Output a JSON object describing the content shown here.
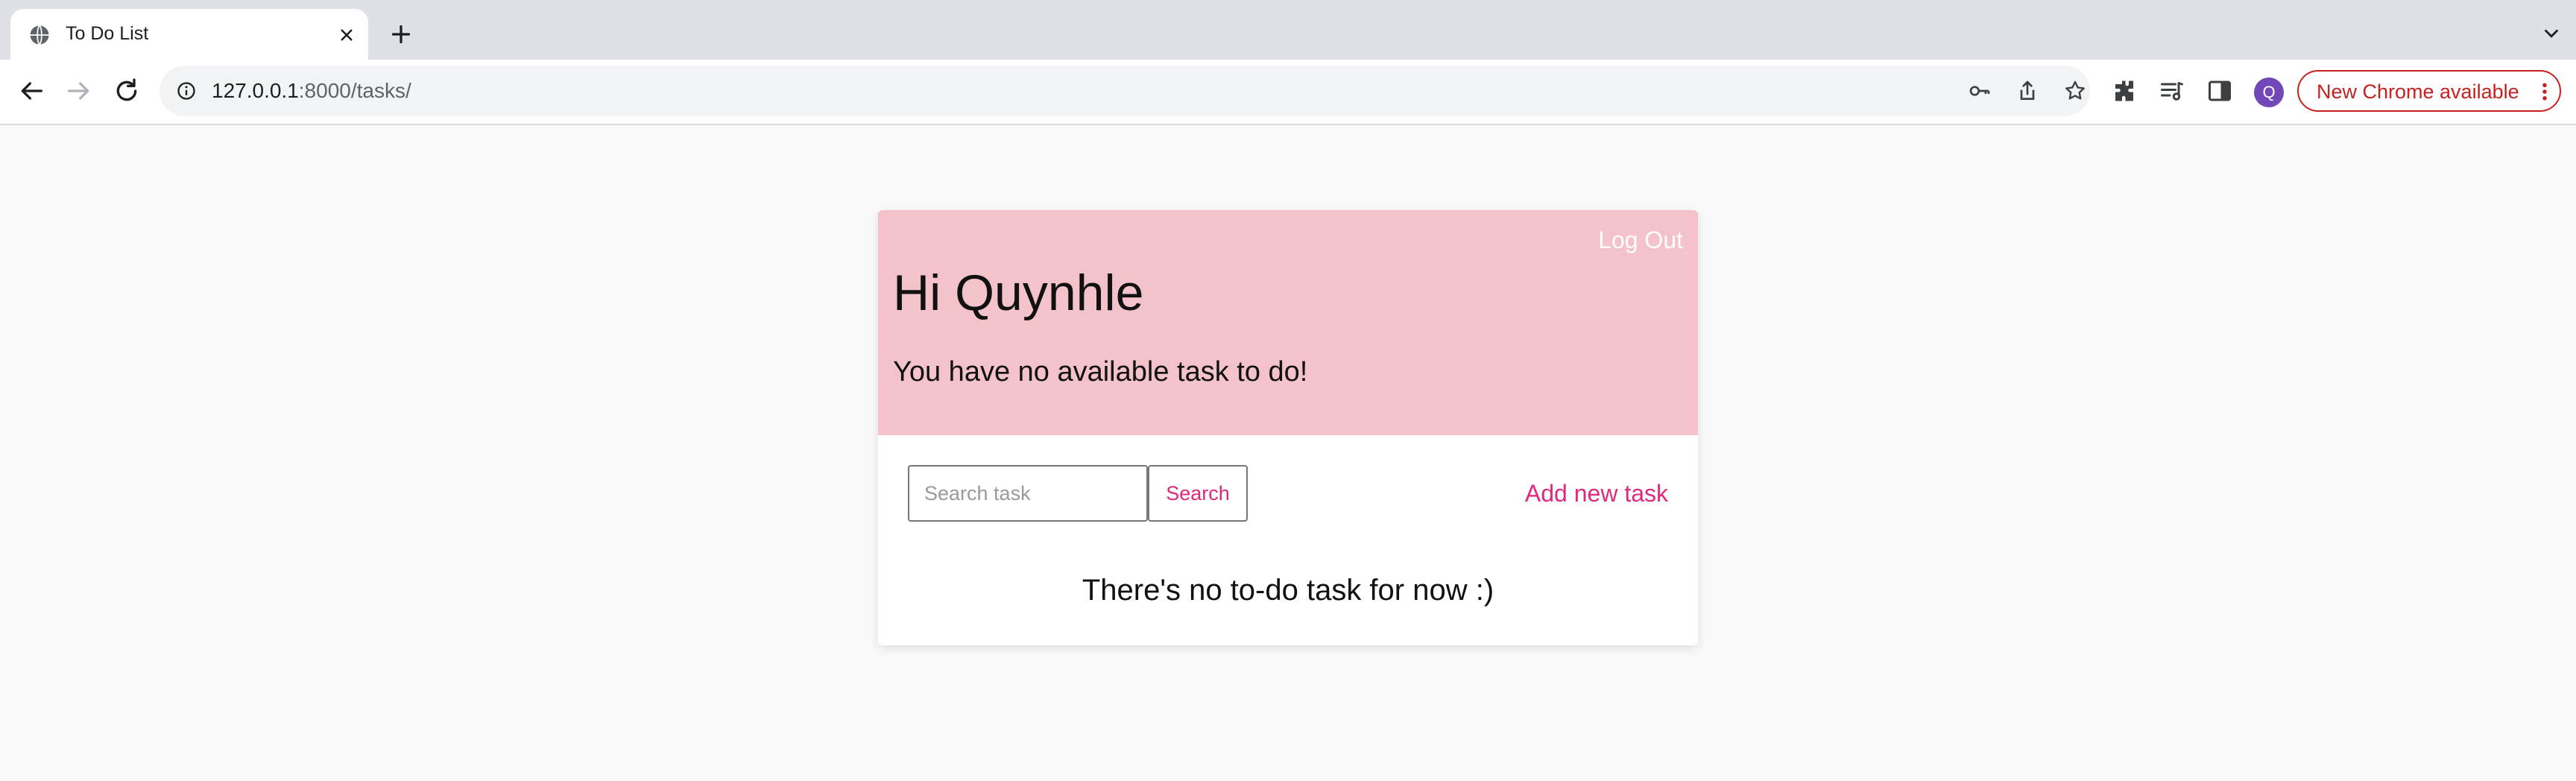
{
  "browser": {
    "tab": {
      "title": "To Do List",
      "favicon": "globe-icon",
      "close_icon": "close-icon"
    },
    "new_tab_icon": "plus-icon",
    "tab_search_icon": "chevron-down-icon",
    "nav": {
      "back_icon": "back-arrow-icon",
      "forward_icon": "forward-arrow-icon",
      "reload_icon": "reload-icon"
    },
    "address_bar": {
      "host": "127.0.0.1",
      "path": ":8000/tasks/",
      "info_icon": "info-icon",
      "password_icon": "key-icon",
      "share_icon": "share-icon",
      "bookmark_icon": "star-icon"
    },
    "toolbar_icons": [
      "extensions-icon",
      "reading-list-icon",
      "side-panel-icon"
    ],
    "profile_initial": "Q",
    "update_label": "New Chrome available",
    "update_menu_icon": "kebab-menu-icon"
  },
  "page": {
    "logout_label": "Log Out",
    "greeting": "Hi Quynhle",
    "summary": "You have no available task to do!",
    "search": {
      "placeholder": "Search task",
      "value": "",
      "button_label": "Search"
    },
    "add_task_label": "Add new task",
    "empty_message": "There's no to-do task for now :)"
  },
  "colors": {
    "header_bg": "#f4c2cb",
    "accent": "#e0287d",
    "update_red": "#c5221f",
    "profile_purple": "#7248b9"
  }
}
